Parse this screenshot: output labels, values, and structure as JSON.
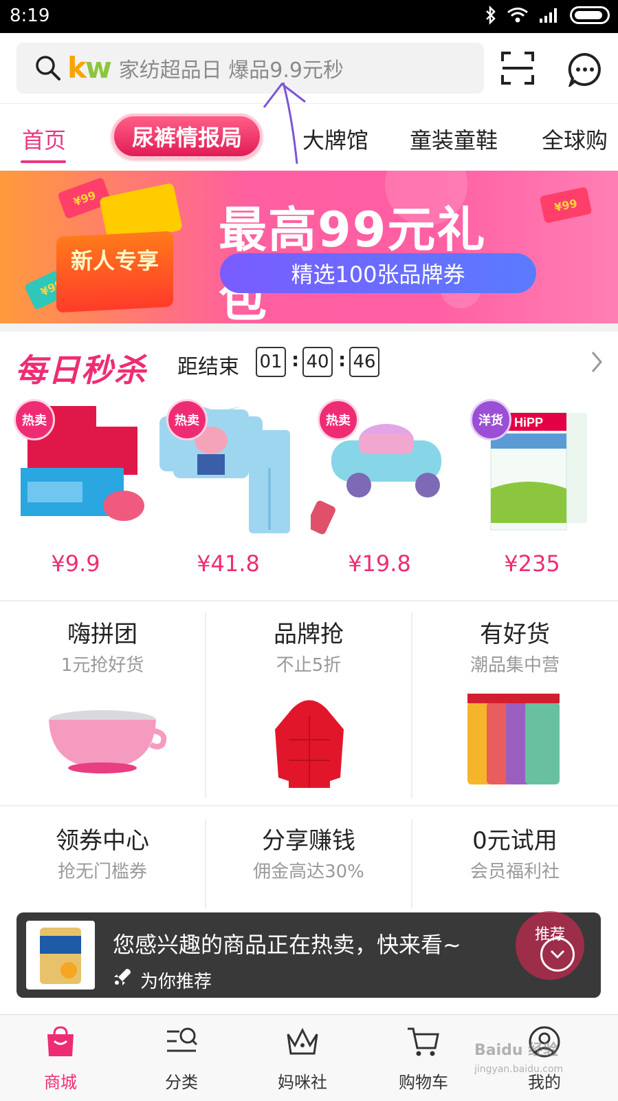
{
  "status_bar": {
    "time": "8:19"
  },
  "search": {
    "logo_k": "k",
    "logo_w": "w",
    "placeholder": "家纺超品日 爆品9.9元秒"
  },
  "tabs": {
    "home": "首页",
    "promo_pill": "尿裤情报局",
    "brands": "大牌馆",
    "kids_wear": "童装童鞋",
    "global": "全球购"
  },
  "banner": {
    "title": "最高99元礼包",
    "subtitle": "精选100张品牌券",
    "gift_label": "新人专享",
    "ticket_text": "¥99"
  },
  "flash_sale": {
    "title": "每日秒杀",
    "ends_label": "距结束",
    "hours": "01",
    "minutes": "40",
    "seconds": "46",
    "products": [
      {
        "badge": "热卖",
        "price": "¥9.9"
      },
      {
        "badge": "热卖",
        "price": "¥41.8"
      },
      {
        "badge": "热卖",
        "price": "¥19.8"
      },
      {
        "badge": "洋货",
        "price": "¥235"
      }
    ]
  },
  "grid": [
    {
      "title": "嗨拼团",
      "subtitle": "1元抢好货"
    },
    {
      "title": "品牌抢",
      "subtitle": "不止5折"
    },
    {
      "title": "有好货",
      "subtitle": "潮品集中营"
    },
    {
      "title": "领券中心",
      "subtitle": "抢无门槛券"
    },
    {
      "title": "分享赚钱",
      "subtitle": "佣金高达30%"
    },
    {
      "title": "0元试用",
      "subtitle": "会员福利社"
    }
  ],
  "toast": {
    "message": "您感兴趣的商品正在热卖，快来看~",
    "sub": "为你推荐",
    "bubble": "推荐"
  },
  "bottom_nav": [
    {
      "label": "商城",
      "icon": "shopping-bag-icon"
    },
    {
      "label": "分类",
      "icon": "category-search-icon"
    },
    {
      "label": "妈咪社",
      "icon": "crown-icon"
    },
    {
      "label": "购物车",
      "icon": "cart-icon"
    },
    {
      "label": "我的",
      "icon": "profile-icon"
    }
  ],
  "watermark": {
    "line1": "Baidu 经验",
    "line2": "jingyan.baidu.com"
  },
  "colors": {
    "accent": "#ee2c74",
    "brand_pink": "#e8397f"
  }
}
